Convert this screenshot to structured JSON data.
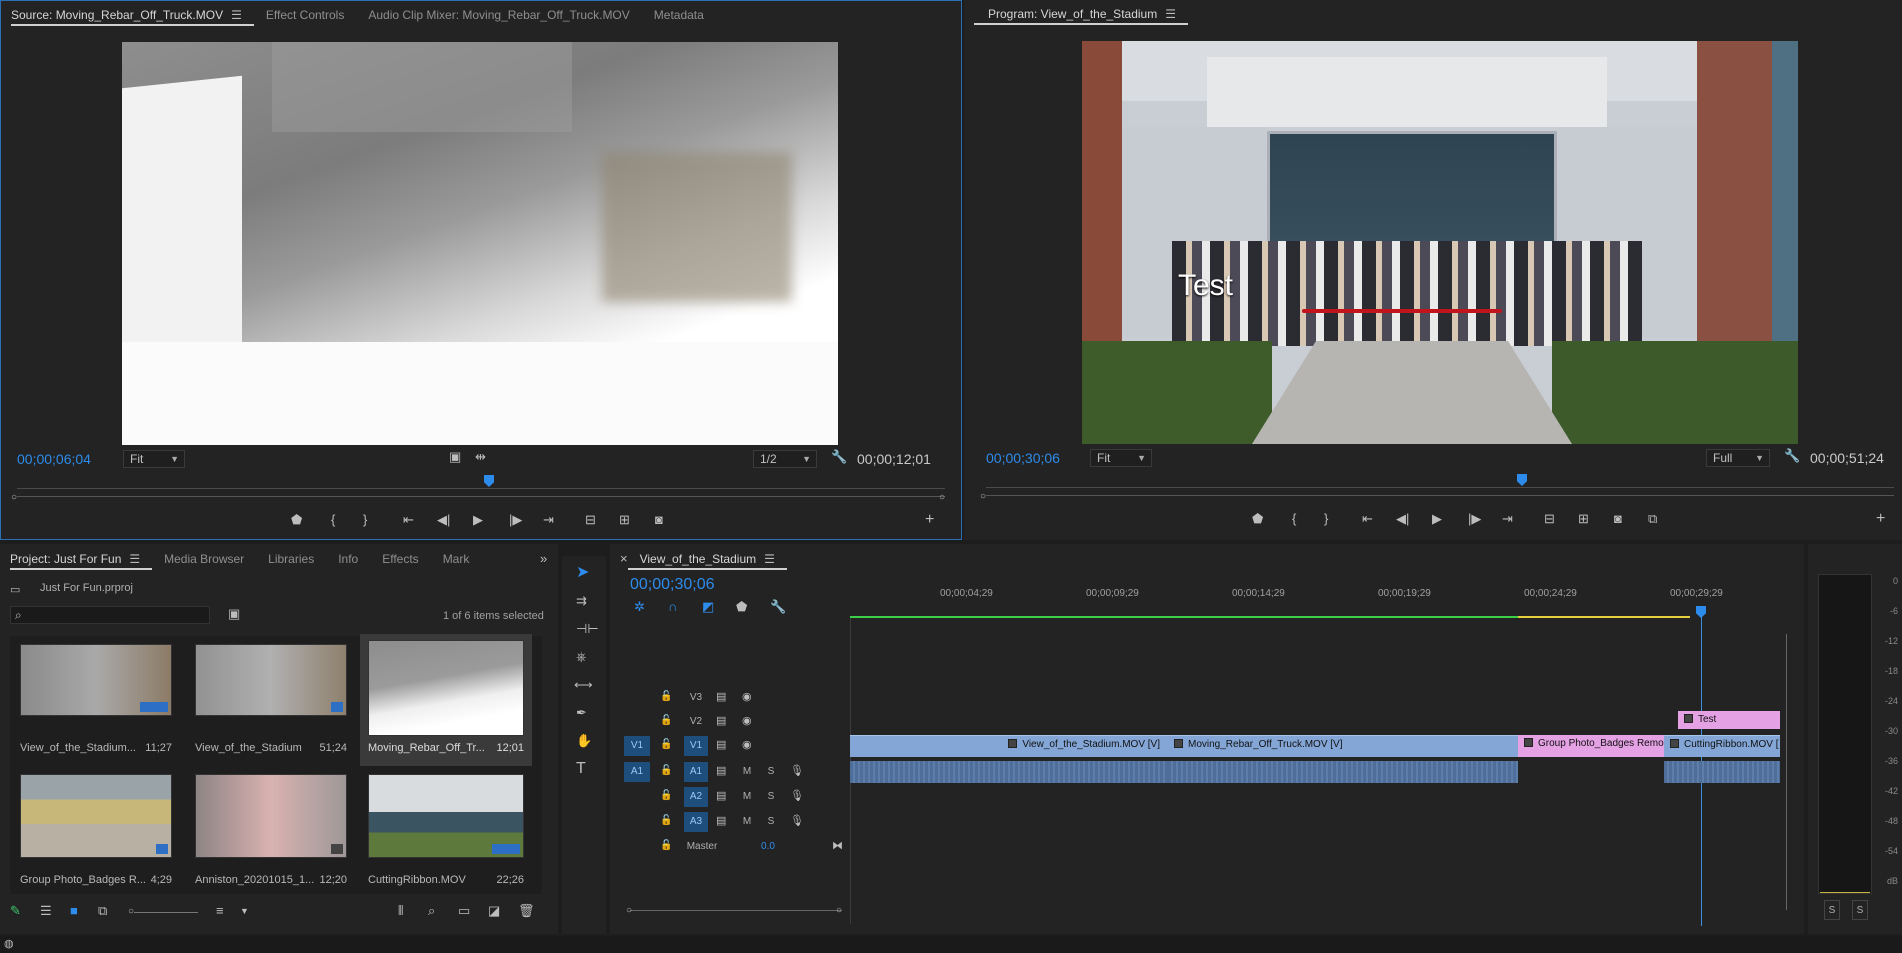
{
  "source": {
    "tabs": [
      "Source: Moving_Rebar_Off_Truck.MOV",
      "Effect Controls",
      "Audio Clip Mixer: Moving_Rebar_Off_Truck.MOV",
      "Metadata"
    ],
    "timecode": "00;00;06;04",
    "fit": "Fit",
    "resolution": "1/2",
    "duration": "00;00;12;01",
    "playhead_fraction": 0.5
  },
  "program": {
    "title": "Program: View_of_the_Stadium",
    "timecode": "00;00;30;06",
    "fit": "Fit",
    "resolution": "Full",
    "duration": "00;00;51;24",
    "overlay_text": "Test",
    "playhead_fraction": 0.59
  },
  "project": {
    "tabs": [
      "Project: Just For Fun",
      "Media Browser",
      "Libraries",
      "Info",
      "Effects",
      "Mark"
    ],
    "file": "Just For Fun.prproj",
    "selection": "1 of 6 items selected",
    "items": [
      {
        "name": "View_of_the_Stadium...",
        "dur": "11;27"
      },
      {
        "name": "View_of_the_Stadium",
        "dur": "51;24"
      },
      {
        "name": "Moving_Rebar_Off_Tr...",
        "dur": "12;01"
      },
      {
        "name": "Group Photo_Badges R...",
        "dur": "4;29"
      },
      {
        "name": "Anniston_20201015_1...",
        "dur": "12;20"
      },
      {
        "name": "CuttingRibbon.MOV",
        "dur": "22;26"
      }
    ]
  },
  "timeline": {
    "sequence": "View_of_the_Stadium",
    "timecode": "00;00;30;06",
    "ruler": [
      "00;00;04;29",
      "00;00;09;29",
      "00;00;14;29",
      "00;00;19;29",
      "00;00;24;29",
      "00;00;29;29"
    ],
    "tracks": {
      "v3": "V3",
      "v2": "V2",
      "v1": "V1",
      "a1": "A1",
      "a2": "A2",
      "a3": "A3",
      "master": "Master",
      "master_val": "0.0"
    },
    "clips": {
      "c1": "View_of_the_Stadium.MOV [V]",
      "c2": "Moving_Rebar_Off_Truck.MOV [V]",
      "c3": "Group Photo_Badges Remo",
      "c4": "CuttingRibbon.MOV [",
      "c5": "Test"
    },
    "m": "M",
    "s": "S"
  },
  "meter": {
    "labels": [
      "0",
      "-6",
      "-12",
      "-18",
      "-24",
      "-30",
      "-36",
      "-42",
      "-48",
      "-54",
      "dB"
    ],
    "solo": "S"
  },
  "colors": {
    "accent": "#2d8ceb",
    "video_clip": "#83a6d6",
    "audio_clip": "#4f6e9a",
    "pink_clip": "#e4a1e3"
  }
}
